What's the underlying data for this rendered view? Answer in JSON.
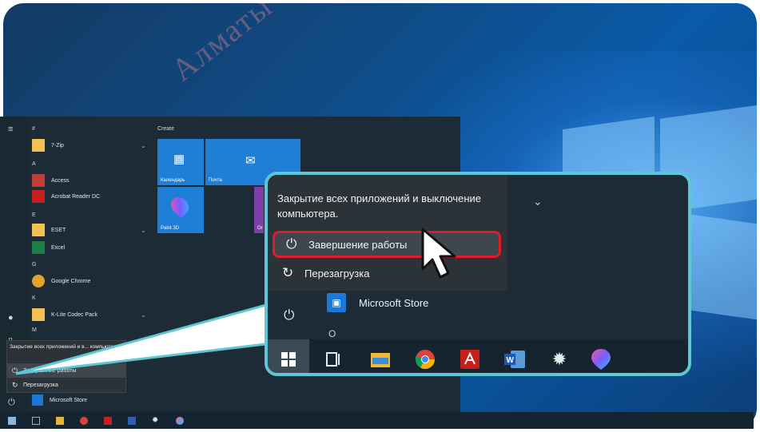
{
  "background": {
    "watermark": "Алматы"
  },
  "start_menu": {
    "rail_icons": [
      "menu-icon",
      "document-icon",
      "settings-icon",
      "power-icon"
    ],
    "sections": [
      {
        "letter": "#",
        "apps": [
          {
            "label": "7-Zip",
            "icon": "folder-icon",
            "color": "#f2c14e",
            "chevron": true
          }
        ]
      },
      {
        "letter": "A",
        "apps": [
          {
            "label": "Access",
            "icon": "access-icon",
            "color": "#c43b3b"
          },
          {
            "label": "Acrobat Reader DC",
            "icon": "acrobat-icon",
            "color": "#c7201c"
          }
        ]
      },
      {
        "letter": "E",
        "apps": [
          {
            "label": "ESET",
            "icon": "folder-icon",
            "color": "#f2c14e",
            "chevron": true
          },
          {
            "label": "Excel",
            "icon": "excel-icon",
            "color": "#1e7c44"
          }
        ]
      },
      {
        "letter": "G",
        "apps": [
          {
            "label": "Google Chrome",
            "icon": "chrome-icon",
            "color": "#e1a32b"
          }
        ]
      },
      {
        "letter": "K",
        "apps": [
          {
            "label": "K-Lite Codec Pack",
            "icon": "folder-icon",
            "color": "#f2c14e",
            "chevron": true
          }
        ]
      },
      {
        "letter": "M",
        "apps": []
      }
    ],
    "tiles_group_label": "Create",
    "tiles": [
      {
        "label": "Календарь",
        "icon": "calendar-icon"
      },
      {
        "label": "Почта",
        "icon": "mail-icon"
      },
      {
        "label": "Paint 3D",
        "icon": "paint3d-icon"
      },
      {
        "label": "Or",
        "icon": "office-icon"
      }
    ]
  },
  "small_popup": {
    "tooltip": "Закрытие всех приложений и в... компьютера.",
    "shutdown": "Завершение работы",
    "restart": "Перезагрузка",
    "store": "Microsoft Store"
  },
  "zoom_popup": {
    "tooltip": "Закрытие всех приложений и выключение компьютера.",
    "shutdown": "Завершение работы",
    "restart": "Перезагрузка",
    "store": "Microsoft Store",
    "accent": "#e21b2b",
    "frame_color": "#5fc6d6"
  },
  "taskbar_icons": [
    "windows-icon",
    "task-view-icon",
    "file-explorer-icon",
    "chrome-icon",
    "acrobat-icon",
    "word-icon",
    "settings-icon",
    "paint3d-icon"
  ]
}
